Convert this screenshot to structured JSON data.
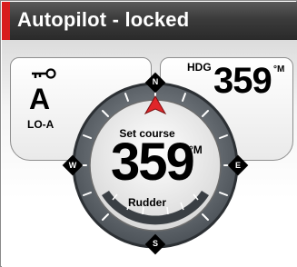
{
  "window": {
    "title": "Autopilot - locked",
    "accent_color": "#d81e1e"
  },
  "mode_panel": {
    "icon": "key-icon",
    "mode": "A",
    "sub": "LO-A"
  },
  "heading_panel": {
    "label": "HDG",
    "value": "359",
    "unit": "°M"
  },
  "compass": {
    "north": "N",
    "east": "E",
    "south": "S",
    "west": "W",
    "set_course_label": "Set course",
    "set_course_value": "359",
    "set_course_unit": "°M",
    "rudder_label": "Rudder",
    "pointer_color": "#e0262a"
  }
}
